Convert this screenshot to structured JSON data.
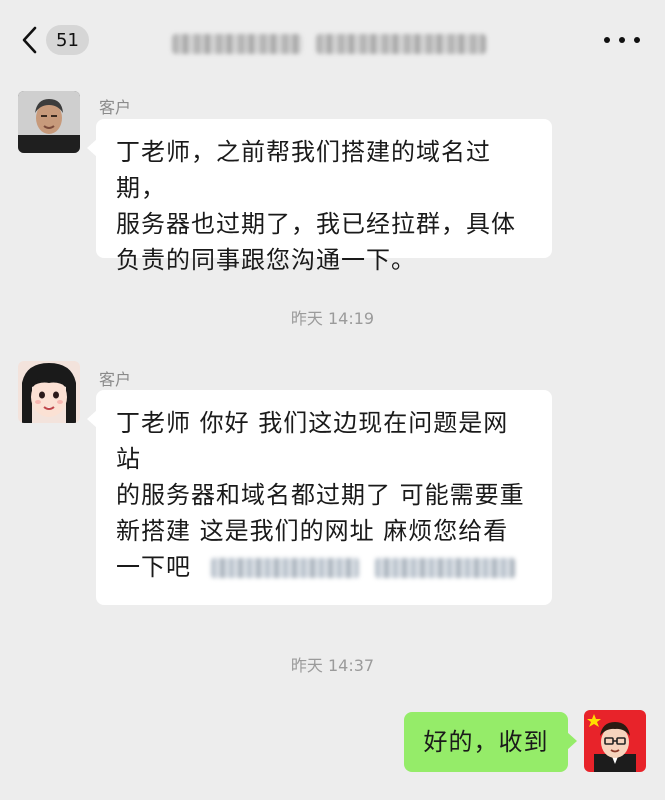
{
  "header": {
    "unread_count": "51"
  },
  "messages": [
    {
      "sender": "客户",
      "lines": [
        "丁老师，之前帮我们搭建的域名过期，",
        "服务器也过期了，我已经拉群，具体",
        "负责的同事跟您沟通一下。"
      ]
    },
    {
      "sender": "客户",
      "lines": [
        "丁老师 你好 我们这边现在问题是网站",
        "的服务器和域名都过期了 可能需要重",
        "新搭建  这是我们的网址  麻烦您给看",
        "一下吧"
      ]
    },
    {
      "text": "好的，收到"
    }
  ],
  "timestamps": [
    "昨天 14:19",
    "昨天 14:37"
  ],
  "colors": {
    "background": "#ededed",
    "incoming_bubble": "#ffffff",
    "outgoing_bubble": "#95ec69",
    "muted_text": "#9b9b9b"
  }
}
